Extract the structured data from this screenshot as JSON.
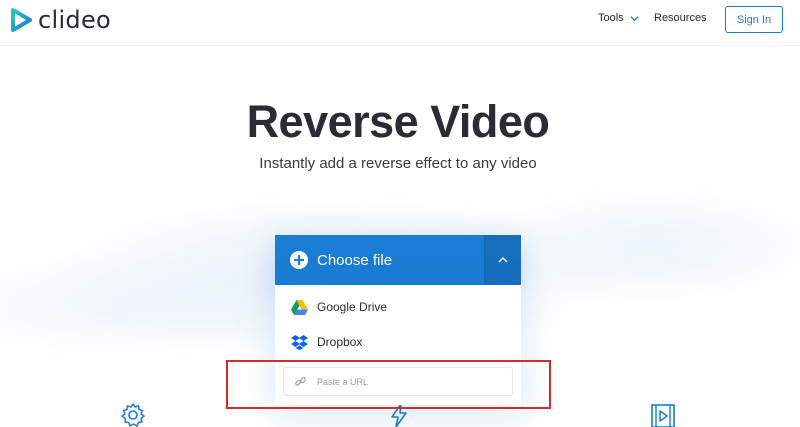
{
  "brand": {
    "name": "clideo",
    "color": "#1a7dd3"
  },
  "nav": {
    "tools_label": "Tools",
    "resources_label": "Resources",
    "signin_label": "Sign In"
  },
  "hero": {
    "title": "Reverse Video",
    "subtitle": "Instantly add a reverse effect to any video"
  },
  "upload": {
    "choose_label": "Choose file",
    "options": [
      {
        "label": "Google Drive",
        "icon": "google-drive-icon"
      },
      {
        "label": "Dropbox",
        "icon": "dropbox-icon"
      }
    ],
    "url_placeholder": "Paste a URL"
  },
  "features": [
    {
      "icon": "gear-icon"
    },
    {
      "icon": "lightning-icon"
    },
    {
      "icon": "video-play-icon"
    }
  ],
  "highlight_color": "#d62b2b"
}
